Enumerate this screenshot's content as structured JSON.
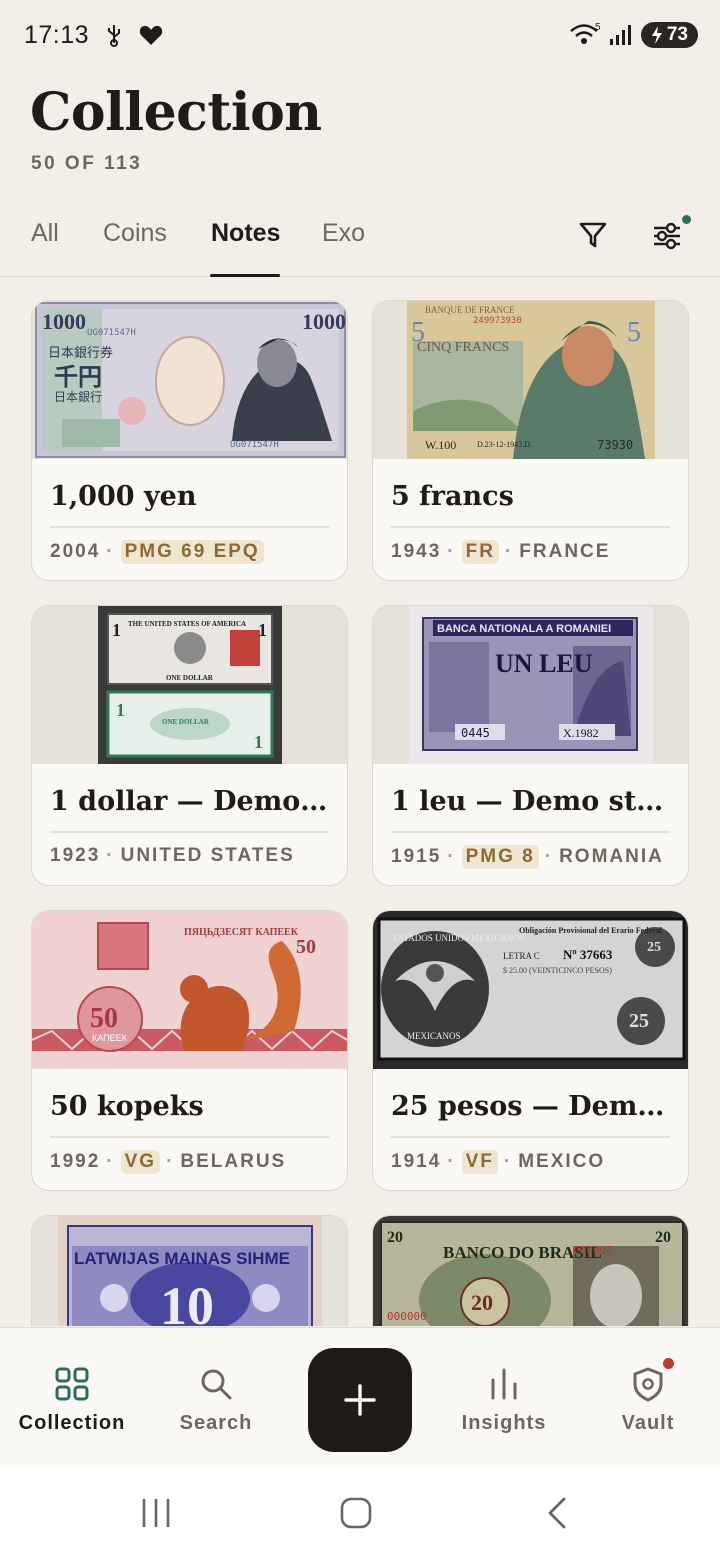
{
  "status_bar": {
    "time": "17:13",
    "battery": "73"
  },
  "header": {
    "title": "Collection",
    "subtitle": "50 OF 113"
  },
  "tabs": [
    {
      "label": "All"
    },
    {
      "label": "Coins"
    },
    {
      "label": "Notes",
      "active": true
    },
    {
      "label": "Exo"
    }
  ],
  "toolbar": {
    "filter_icon": "filter-icon",
    "settings_icon": "sliders-icon"
  },
  "cards": [
    {
      "title": "1,000 yen",
      "year": "2004",
      "grade": "PMG 69 EPQ",
      "country": ""
    },
    {
      "title": "5 francs",
      "year": "1943",
      "grade": "FR",
      "country": "FRANCE"
    },
    {
      "title": "1 dollar — Demo s...",
      "year": "1923",
      "grade": "",
      "country": "UNITED STATES"
    },
    {
      "title": "1 leu — Demo stu...",
      "year": "1915",
      "grade": "PMG 8",
      "country": "ROMANIA"
    },
    {
      "title": "50 kopeks",
      "year": "1992",
      "grade": "VG",
      "country": "BELARUS"
    },
    {
      "title": "25 pesos — Demo...",
      "year": "1914",
      "grade": "VF",
      "country": "MEXICO"
    }
  ],
  "note_images": {
    "yen": {
      "denomination": "1000",
      "serial": "UG071547H",
      "script": "日本銀行券",
      "value_kanji": "千円",
      "issuer": "日本銀行"
    },
    "francs": {
      "bank": "BANQUE DE FRANCE",
      "serial": "249973930",
      "words": "CINQ FRANCS",
      "denomination": "5",
      "letter": "W.100",
      "date": "D.23-12-1943.D.",
      "number": "73930"
    },
    "dollar": {
      "header": "THE UNITED STATES OF AMERICA",
      "words": "ONE DOLLAR",
      "numeral": "1"
    },
    "leu": {
      "bank": "BANCA NATIONALA A ROMANIEI",
      "words": "UN LEU",
      "serial": "0445",
      "series": "X.1982"
    },
    "kopeks": {
      "header": "ПЯЦЬДЗЕСЯТ КАПЕЕК",
      "denomination": "50",
      "unit": "КАПЕЕК"
    },
    "pesos": {
      "header": "ESTADOS UNIDOS MEXICANOS",
      "title": "Obligación Provisional del Erario Federal",
      "letter": "LETRA C",
      "number": "Nº 37663",
      "amount": "$ 25.00 (VEINTICINCO PESOS)",
      "denomination": "25",
      "footer": "MEXICANOS"
    },
    "latvia": {
      "header": "LATWIJAS MAINAS SIHME",
      "denomination": "10"
    },
    "brasil": {
      "header": "BANCO DO BRASIL",
      "denomination": "20",
      "serial": "000000"
    }
  },
  "bottom_nav": [
    {
      "label": "Collection",
      "icon": "grid-icon",
      "active": true
    },
    {
      "label": "Search",
      "icon": "search-icon"
    },
    {
      "label": "",
      "icon": "plus-icon"
    },
    {
      "label": "Insights",
      "icon": "bar-chart-icon"
    },
    {
      "label": "Vault",
      "icon": "shield-icon"
    }
  ],
  "colors": {
    "background": "#f3efe8",
    "accent": "#2e6b5a",
    "grade_bg": "#f0e5d0",
    "grade_text": "#8c6a35"
  }
}
